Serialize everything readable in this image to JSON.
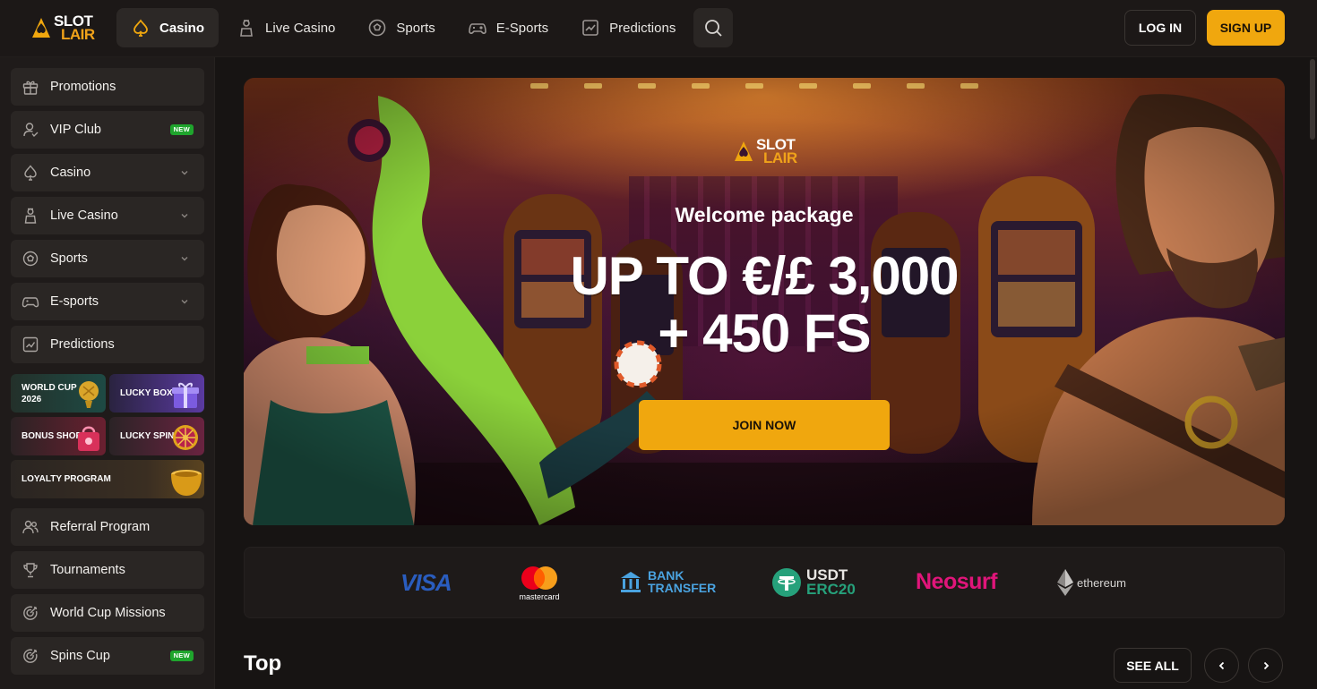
{
  "brand": {
    "line1": "SLOT",
    "line2": "LAIR",
    "accent": "#f0a70e"
  },
  "header": {
    "nav": [
      {
        "label": "Casino",
        "icon": "spade-icon",
        "active": true
      },
      {
        "label": "Live Casino",
        "icon": "dealer-icon"
      },
      {
        "label": "Sports",
        "icon": "football-icon"
      },
      {
        "label": "E-Sports",
        "icon": "gamepad-icon"
      },
      {
        "label": "Predictions",
        "icon": "chart-icon"
      }
    ],
    "login_label": "LOG IN",
    "signup_label": "SIGN UP"
  },
  "sidebar": {
    "items_top": [
      {
        "label": "Promotions",
        "icon": "gift-icon"
      },
      {
        "label": "VIP Club",
        "icon": "vip-user-icon",
        "badge": "NEW"
      },
      {
        "label": "Casino",
        "icon": "spade-icon",
        "expandable": true
      },
      {
        "label": "Live Casino",
        "icon": "dealer-icon",
        "expandable": true
      },
      {
        "label": "Sports",
        "icon": "football-icon",
        "expandable": true
      },
      {
        "label": "E-sports",
        "icon": "gamepad-icon",
        "expandable": true
      },
      {
        "label": "Predictions",
        "icon": "chart-icon"
      }
    ],
    "tiles": [
      {
        "line1": "WORLD CUP",
        "line2": "2026"
      },
      {
        "line1": "LUCKY BOX",
        "line2": ""
      },
      {
        "line1": "BONUS SHOP",
        "line2": ""
      },
      {
        "line1": "LUCKY SPIN",
        "line2": ""
      },
      {
        "line1": "LOYALTY PROGRAM",
        "line2": ""
      }
    ],
    "items_bottom": [
      {
        "label": "Referral Program",
        "icon": "users-icon"
      },
      {
        "label": "Tournaments",
        "icon": "trophy-icon"
      },
      {
        "label": "World Cup Missions",
        "icon": "target-icon"
      },
      {
        "label": "Spins Cup",
        "icon": "target-icon",
        "badge": "NEW"
      }
    ]
  },
  "hero": {
    "welcome": "Welcome package",
    "headline_line1": "UP TO €/£ 3,000",
    "headline_line2": "+ 450 FS",
    "cta_label": "JOIN NOW"
  },
  "payments": {
    "visa": "VISA",
    "mastercard": "mastercard",
    "bank_line1": "BANK",
    "bank_line2": "TRANSFER",
    "usdt_line1": "USDT",
    "usdt_line2": "ERC20",
    "neosurf": "Neosurf",
    "ethereum": "ethereum"
  },
  "section": {
    "title": "Top",
    "see_all_label": "SEE ALL"
  }
}
